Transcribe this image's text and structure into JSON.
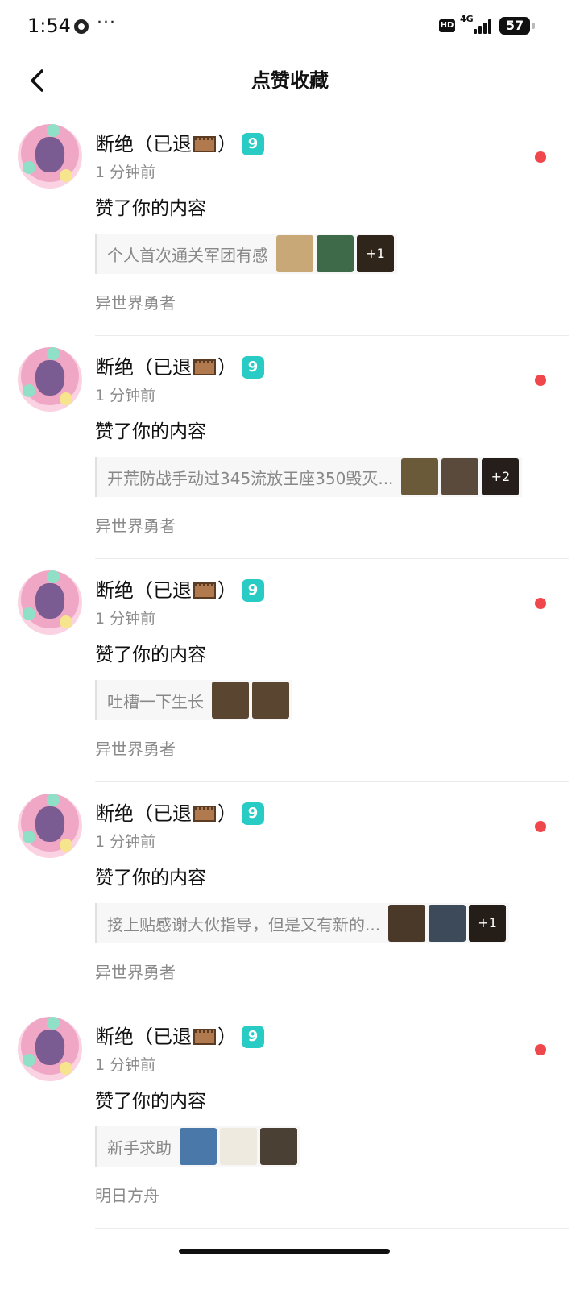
{
  "status_bar": {
    "time": "1:54",
    "dots": "···",
    "hd": "HD",
    "network": "4G",
    "battery": "57"
  },
  "header": {
    "title": "点赞收藏",
    "back_icon": "chevron-left-icon"
  },
  "notifications": [
    {
      "user_name_prefix": "断绝（已退",
      "user_name_suffix": "）",
      "level": "9",
      "time_ago": "1 分钟前",
      "action": "赞了你的内容",
      "post_excerpt": "个人首次通关军团有感",
      "thumbnails": [
        {
          "color": "#c9a878"
        },
        {
          "color": "#3f6a4a"
        },
        {
          "color": "#4a3a2a",
          "more": "+1"
        }
      ],
      "game": "异世界勇者",
      "unread": true
    },
    {
      "user_name_prefix": "断绝（已退",
      "user_name_suffix": "）",
      "level": "9",
      "time_ago": "1 分钟前",
      "action": "赞了你的内容",
      "post_excerpt": "开荒防战手动过345流放王座350毁灭...",
      "thumbnails": [
        {
          "color": "#6b5a3a"
        },
        {
          "color": "#5a4a3c"
        },
        {
          "color": "#3a2e28",
          "more": "+2"
        }
      ],
      "game": "异世界勇者",
      "unread": true
    },
    {
      "user_name_prefix": "断绝（已退",
      "user_name_suffix": "）",
      "level": "9",
      "time_ago": "1 分钟前",
      "action": "赞了你的内容",
      "post_excerpt": "吐槽一下生长",
      "thumbnails": [
        {
          "color": "#5a4630"
        },
        {
          "color": "#5a4630"
        }
      ],
      "game": "异世界勇者",
      "unread": true
    },
    {
      "user_name_prefix": "断绝（已退",
      "user_name_suffix": "）",
      "level": "9",
      "time_ago": "1 分钟前",
      "action": "赞了你的内容",
      "post_excerpt": "接上贴感谢大伙指导，但是又有新的...",
      "thumbnails": [
        {
          "color": "#4a3828"
        },
        {
          "color": "#3c4a5a"
        },
        {
          "color": "#3a2e26",
          "more": "+1"
        }
      ],
      "game": "异世界勇者",
      "unread": true
    },
    {
      "user_name_prefix": "断绝（已退",
      "user_name_suffix": "）",
      "level": "9",
      "time_ago": "1 分钟前",
      "action": "赞了你的内容",
      "post_excerpt": "新手求助",
      "thumbnails": [
        {
          "color": "#4a78a8"
        },
        {
          "color": "#eeeae0"
        },
        {
          "color": "#4a4034"
        }
      ],
      "game": "明日方舟",
      "unread": true
    }
  ]
}
